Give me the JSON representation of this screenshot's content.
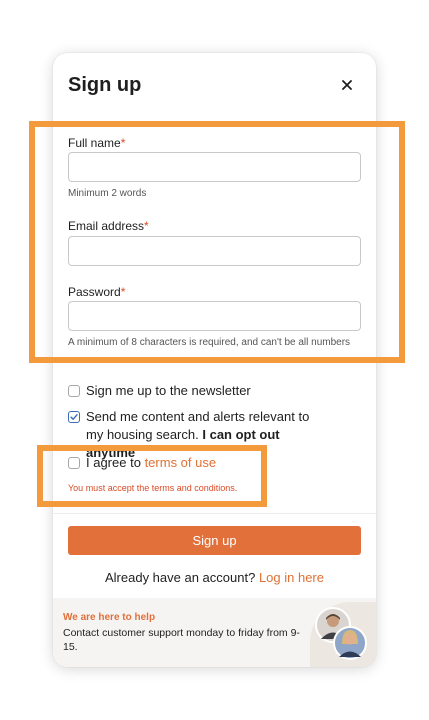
{
  "dialog": {
    "title": "Sign up",
    "close_icon": "close-icon"
  },
  "form": {
    "full_name": {
      "label": "Full name",
      "required_mark": "*",
      "value": "",
      "placeholder": "",
      "hint": "Minimum 2 words"
    },
    "email": {
      "label": "Email address",
      "required_mark": "*",
      "value": "",
      "placeholder": ""
    },
    "password": {
      "label": "Password",
      "required_mark": "*",
      "value": "",
      "placeholder": "",
      "hint": "A minimum of 8 characters is required, and can't be all numbers"
    }
  },
  "checkboxes": {
    "newsletter": {
      "label": "Sign me up to the newsletter",
      "checked": false
    },
    "alerts": {
      "label": "Send me content and alerts relevant to my housing search.",
      "label_bold": "I can opt out anytime",
      "checked": true
    },
    "terms": {
      "label_prefix": "I agree to",
      "link": "terms of use",
      "checked": false,
      "error": "You must accept the terms and conditions."
    }
  },
  "actions": {
    "submit_label": "Sign up",
    "login_prompt": "Already have an account?",
    "login_link": "Log in here"
  },
  "footer": {
    "title": "We are here to help",
    "text": "Contact customer support monday to friday from 9-15."
  },
  "colors": {
    "accent": "#e1703b",
    "error": "#d94b26",
    "annotation_highlight": "#f29a3c"
  }
}
